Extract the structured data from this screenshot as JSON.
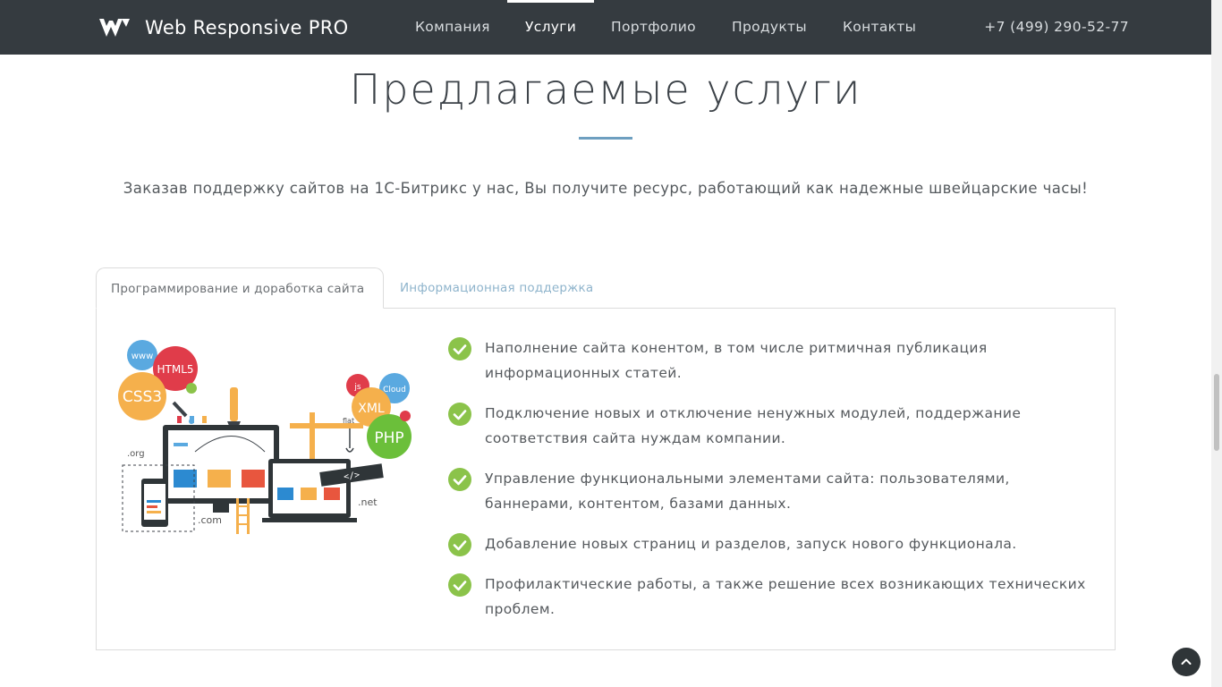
{
  "colors": {
    "navbar_bg": "#353b40",
    "accent_underline": "#6e9fc0",
    "check_green": "#8bc34a",
    "tab_inactive": "#8fb4cc"
  },
  "header": {
    "brand_name": "Web Responsive PRO",
    "logo_icon": "w-logo-icon",
    "nav": [
      {
        "label": "Компания",
        "active": false
      },
      {
        "label": "Услуги",
        "active": true
      },
      {
        "label": "Портфолио",
        "active": false
      },
      {
        "label": "Продукты",
        "active": false
      },
      {
        "label": "Контакты",
        "active": false
      }
    ],
    "phone": "+7 (499) 290-52-77"
  },
  "main": {
    "title": "Предлагаемые услуги",
    "lead": "Заказав поддержку сайтов на 1С-Битрикс у нас, Вы получите ресурс, работающий как надежные швейцарские часы!",
    "tabs": [
      {
        "label": "Программирование и доработка сайта",
        "active": true
      },
      {
        "label": "Информационная поддержка",
        "active": false
      }
    ],
    "illustration": {
      "labels": [
        "www",
        "HTML5",
        "CSS3",
        "js",
        "Cloud",
        "XML",
        "PHP",
        "flat",
        ".org",
        ".com",
        ".net",
        "</>"
      ]
    },
    "features": [
      "Наполнение сайта конентом, в том числе ритмичная публикация информационных статей.",
      "Подключение новых и отключение ненужных модулей, поддержание соответствия сайта нуждам компании.",
      "Управление функциональными элементами сайта: пользователями, баннерами, контентом, базами данных.",
      "Добавление новых страниц и разделов, запуск нового функционала.",
      "Профилактические работы, а также решение всех возникающих технических проблем."
    ],
    "check_icon": "check-circle-icon"
  },
  "scroll_top_icon": "chevron-up-icon"
}
